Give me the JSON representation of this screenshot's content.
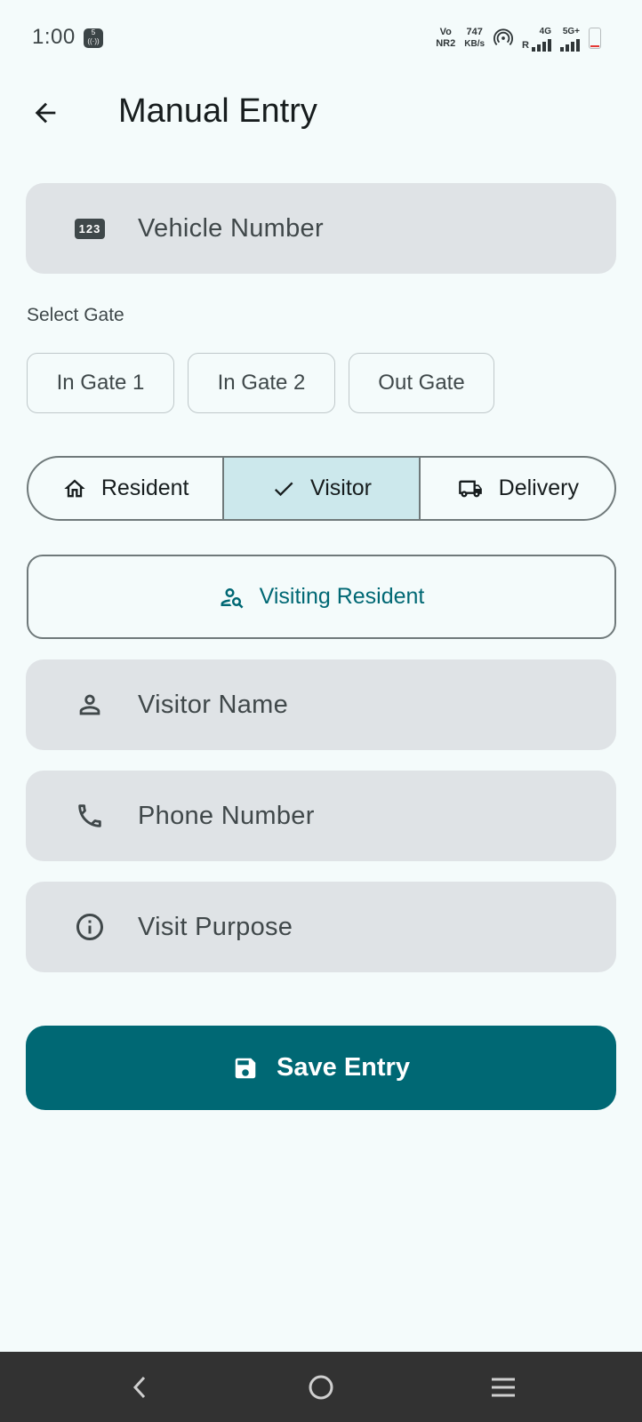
{
  "status_bar": {
    "time": "1:00",
    "notification_badge": "5",
    "volte_top": "Vo",
    "volte_bottom": "NR2",
    "speed_value": "747",
    "speed_unit": "KB/s",
    "roaming": "R",
    "network_1": "4G",
    "network_2": "5G+"
  },
  "app_bar": {
    "title": "Manual Entry"
  },
  "form": {
    "vehicle_number_label": "Vehicle Number",
    "vehicle_icon_text": "123",
    "select_gate_label": "Select Gate",
    "gates": [
      "In Gate 1",
      "In Gate 2",
      "Out Gate"
    ],
    "entry_types": [
      {
        "label": "Resident",
        "icon": "home-icon",
        "selected": false
      },
      {
        "label": "Visitor",
        "icon": "check-icon",
        "selected": true
      },
      {
        "label": "Delivery",
        "icon": "truck-icon",
        "selected": false
      }
    ],
    "visiting_resident_label": "Visiting Resident",
    "visitor_name_label": "Visitor Name",
    "phone_number_label": "Phone Number",
    "visit_purpose_label": "Visit Purpose",
    "save_label": "Save Entry"
  },
  "colors": {
    "primary": "#006874",
    "background": "#f4fbfb",
    "field_fill": "#dfe3e6",
    "selected_segment": "#cce8ec"
  }
}
